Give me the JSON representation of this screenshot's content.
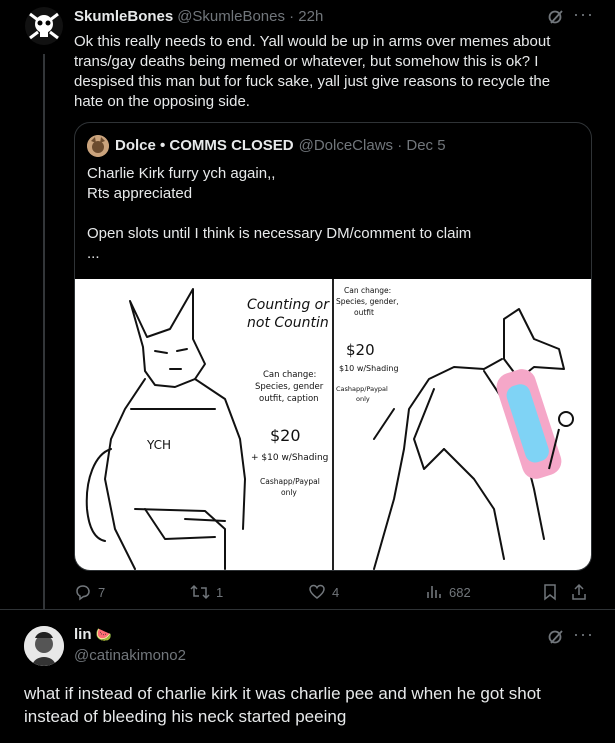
{
  "post1": {
    "display_name": "SkumleBones",
    "handle_time": "@SkumleBones · 22h",
    "text": "Ok this really needs to end. Yall would be up in arms over memes about trans/gay deaths being memed or whatever, but somehow this is ok? I despised this man but for fuck sake, yall just give reasons to recycle the hate on the opposing side.",
    "quote": {
      "display_name": "Dolce • COMMS CLOSED",
      "handle_time": "@DolceClaws · Dec 5",
      "text": "Charlie Kirk furry ych again,,\nRts appreciated\n\nOpen slots until I think is necessary DM/comment to claim\n...",
      "image_left": {
        "heading": "Counting or\nnot Countin",
        "shirt": "YCH",
        "change": "Can change:\nSpecies, gender\noutfit, caption",
        "price": "$20",
        "shading": "+ $10 w/Shading",
        "payment": "Cashapp/Paypal\nonly"
      },
      "image_right": {
        "change": "Can change:\nSpecies, gender,\noutfit",
        "price": "$20",
        "shading": "$10 w/Shading",
        "payment": "Cashapp/Paypal\nonly"
      }
    },
    "actions": {
      "replies": "7",
      "reposts": "1",
      "likes": "4",
      "views": "682"
    }
  },
  "post2": {
    "display_name": "lin",
    "emoji": "🍉",
    "handle": "@catinakimono2",
    "text": "what if instead of charlie kirk it was charlie pee and when he got shot instead of bleeding his neck started peeing"
  },
  "icons": {
    "grok": "grok-icon",
    "more": "more-icon",
    "reply": "reply-icon",
    "repost": "repost-icon",
    "like": "like-icon",
    "views": "views-icon",
    "bookmark": "bookmark-icon",
    "share": "share-icon"
  }
}
